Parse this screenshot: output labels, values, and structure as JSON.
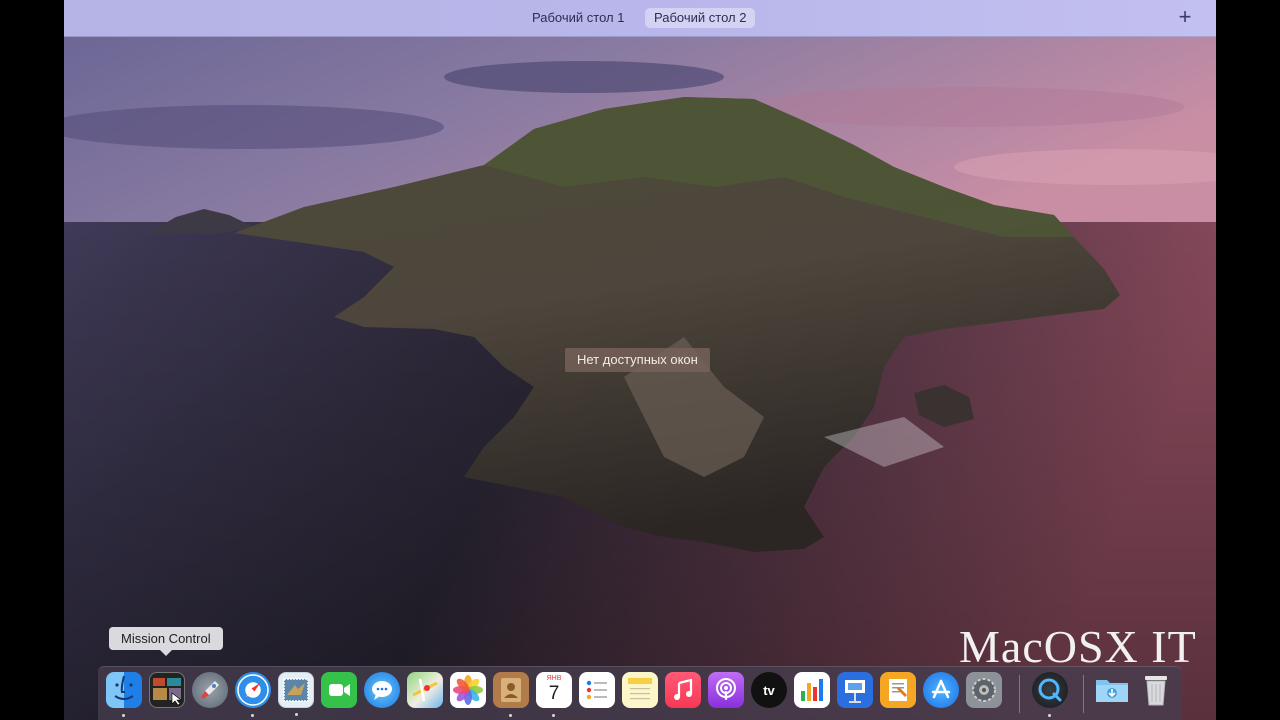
{
  "spaces_bar": {
    "tabs": [
      {
        "label": "Рабочий стол 1",
        "active": false
      },
      {
        "label": "Рабочий стол 2",
        "active": true
      }
    ],
    "add_label": "+"
  },
  "desktop": {
    "no_windows_label": "Нет доступных окон",
    "watermark": "MacOSX IT"
  },
  "dock": {
    "tooltip": "Mission Control",
    "calendar_month": "ЯНВ",
    "calendar_day": "7",
    "tv_label": "tv",
    "items": [
      {
        "name": "finder",
        "running": true
      },
      {
        "name": "mission-control",
        "running": false
      },
      {
        "name": "launchpad",
        "running": false
      },
      {
        "name": "safari",
        "running": true
      },
      {
        "name": "mail",
        "running": true
      },
      {
        "name": "facetime",
        "running": false
      },
      {
        "name": "messages",
        "running": false
      },
      {
        "name": "maps",
        "running": false
      },
      {
        "name": "photos",
        "running": false
      },
      {
        "name": "contacts",
        "running": true
      },
      {
        "name": "calendar",
        "running": true
      },
      {
        "name": "reminders",
        "running": false
      },
      {
        "name": "notes",
        "running": false
      },
      {
        "name": "music",
        "running": false
      },
      {
        "name": "podcasts",
        "running": false
      },
      {
        "name": "tv",
        "running": false
      },
      {
        "name": "numbers",
        "running": false
      },
      {
        "name": "keynote",
        "running": false
      },
      {
        "name": "pages",
        "running": false
      },
      {
        "name": "app-store",
        "running": false
      },
      {
        "name": "system-preferences",
        "running": false
      },
      {
        "name": "quicktime",
        "running": true
      },
      {
        "name": "downloads",
        "running": false
      },
      {
        "name": "trash",
        "running": false
      }
    ]
  },
  "colors": {
    "accent_blue": "#1a7cf0",
    "dock_bg": "#463e4e",
    "spaces_bar": "#b8b6ea"
  }
}
